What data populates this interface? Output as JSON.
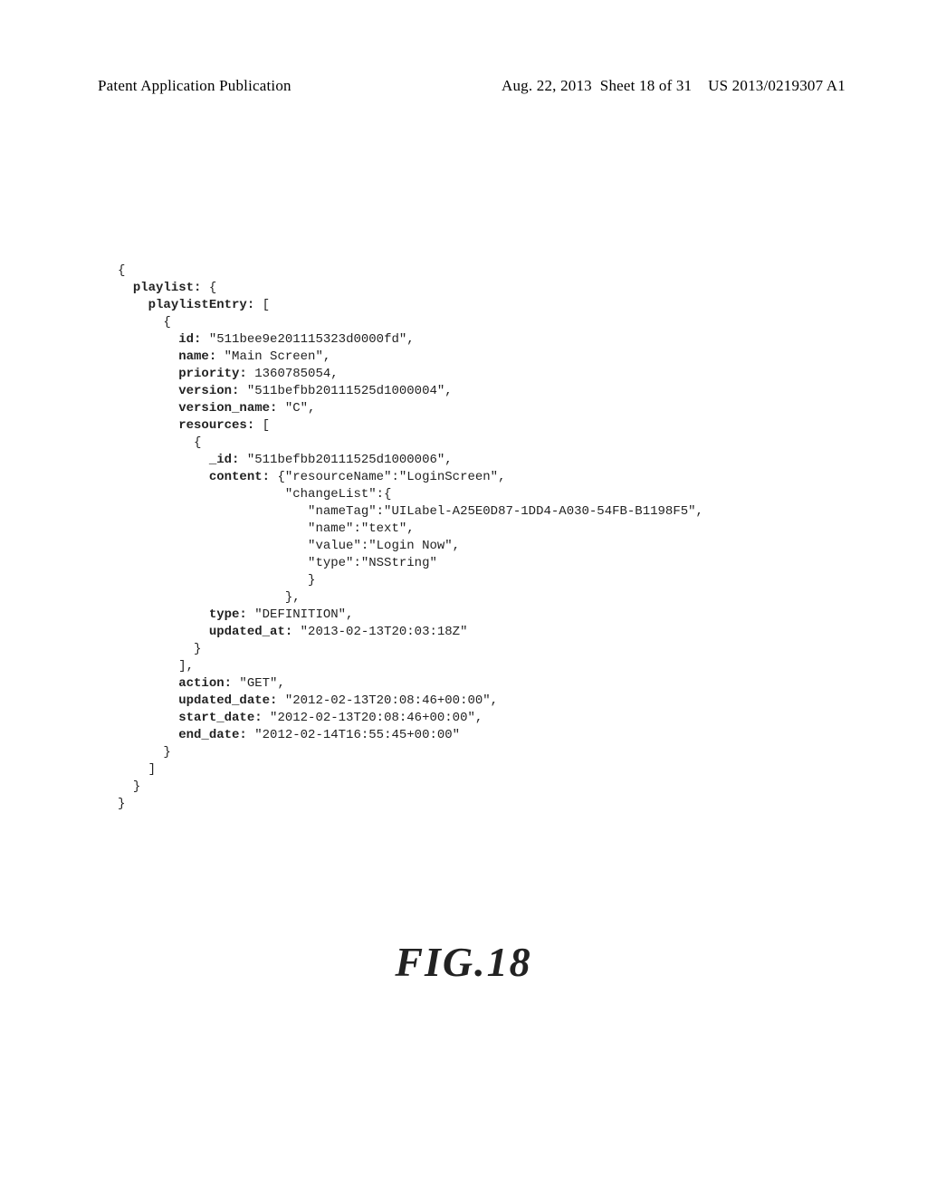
{
  "header": {
    "left": "Patent Application Publication",
    "date": "Aug. 22, 2013",
    "sheet": "Sheet 18 of 31",
    "docnum": "US 2013/0219307 A1"
  },
  "figure_label": "FIG.18",
  "code": {
    "entry": {
      "id_key": "id:",
      "id_val": " \"511bee9e201115323d0000fd\",",
      "name_key": "name:",
      "name_val": " \"Main Screen\",",
      "priority_key": "priority:",
      "priority_val": " 1360785054,",
      "version_key": "version:",
      "version_val": " \"511befbb20111525d1000004\",",
      "version_name_key": "version_name:",
      "version_name_val": " \"C\",",
      "resources_key": "resources:",
      "resources_open": " [",
      "res_id_key": "_id:",
      "res_id_val": " \"511befbb20111525d1000006\",",
      "content_key": "content:",
      "content_line1": " {\"resourceName\":\"LoginScreen\",",
      "content_line2": "\"changeList\":{",
      "content_line3": "\"nameTag\":\"UILabel-A25E0D87-1DD4-A030-54FB-B1198F5\",",
      "content_line4": "\"name\":\"text\",",
      "content_line5": "\"value\":\"Login Now\",",
      "content_line6": "\"type\":\"NSString\"",
      "type_key": "type:",
      "type_val": " \"DEFINITION\",",
      "updated_at_key": "updated_at:",
      "updated_at_val": " \"2013-02-13T20:03:18Z\"",
      "action_key": "action:",
      "action_val": " \"GET\",",
      "updated_date_key": "updated_date:",
      "updated_date_val": " \"2012-02-13T20:08:46+00:00\",",
      "start_date_key": "start_date:",
      "start_date_val": " \"2012-02-13T20:08:46+00:00\",",
      "end_date_key": "end_date:",
      "end_date_val": " \"2012-02-14T16:55:45+00:00\""
    },
    "braces": {
      "open": "{",
      "playlist_key": "playlist:",
      "playlist_open": " {",
      "playlistEntry_key": "playlistEntry:",
      "playlistEntry_open": " [",
      "entry_open": "{",
      "entry_close": "}",
      "inner_close1": "}",
      "inner_close2": "},",
      "list_close": "],",
      "arr_close": "]",
      "obj_close": "}"
    }
  }
}
